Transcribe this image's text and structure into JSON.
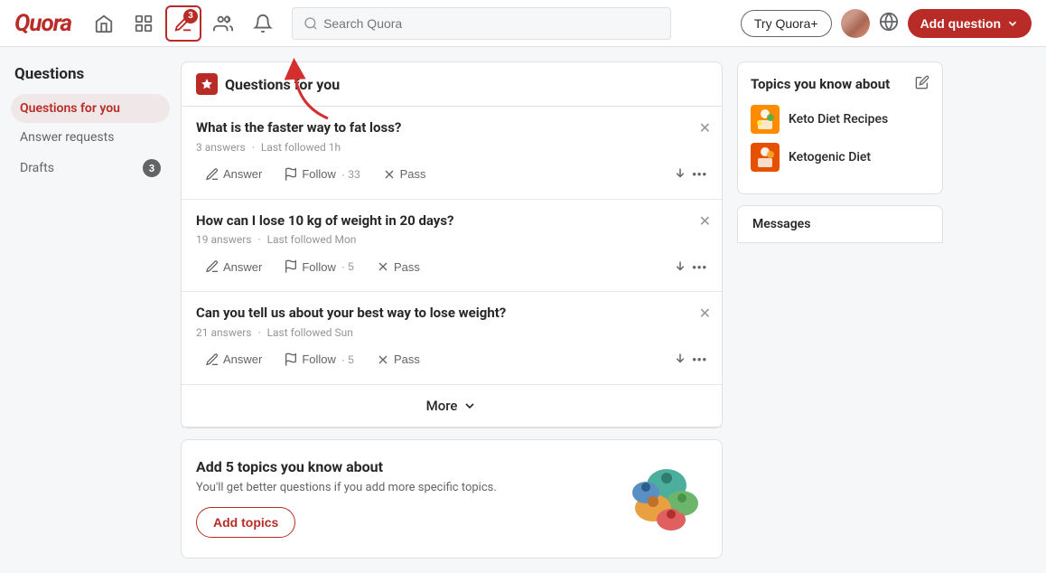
{
  "header": {
    "logo": "Quora",
    "search_placeholder": "Search Quora",
    "try_quora_label": "Try Quora+",
    "add_question_label": "Add question",
    "nav_badge": "3"
  },
  "sidebar": {
    "section_title": "Questions",
    "items": [
      {
        "id": "questions-for-you",
        "label": "Questions for you",
        "active": true,
        "badge": null
      },
      {
        "id": "answer-requests",
        "label": "Answer requests",
        "active": false,
        "badge": null
      },
      {
        "id": "drafts",
        "label": "Drafts",
        "active": false,
        "badge": "3"
      }
    ]
  },
  "main": {
    "panel_header_label": "Questions for you",
    "questions": [
      {
        "id": "q1",
        "title": "What is the faster way to fat loss?",
        "answers": "3 answers",
        "last_followed": "Last followed 1h",
        "follow_count": "33"
      },
      {
        "id": "q2",
        "title": "How can I lose 10 kg of weight in 20 days?",
        "answers": "19 answers",
        "last_followed": "Last followed Mon",
        "follow_count": "5"
      },
      {
        "id": "q3",
        "title": "Can you tell us about your best way to lose weight?",
        "answers": "21 answers",
        "last_followed": "Last followed Sun",
        "follow_count": "5"
      }
    ],
    "more_label": "More",
    "add_topics": {
      "title": "Add 5 topics you know about",
      "description": "You'll get better questions if you add more specific topics.",
      "button_label": "Add topics"
    },
    "action_labels": {
      "answer": "Answer",
      "follow": "Follow",
      "pass": "Pass"
    }
  },
  "right_sidebar": {
    "topics_title": "Topics you know about",
    "topics": [
      {
        "name": "Keto Diet Recipes"
      },
      {
        "name": "Ketogenic Diet"
      }
    ],
    "messages_label": "Messages"
  },
  "icons": {
    "answer": "✏",
    "follow": "📶",
    "pass": "✕",
    "down_vote": "↓",
    "more_dots": "•••",
    "chevron_down": "⌄"
  }
}
